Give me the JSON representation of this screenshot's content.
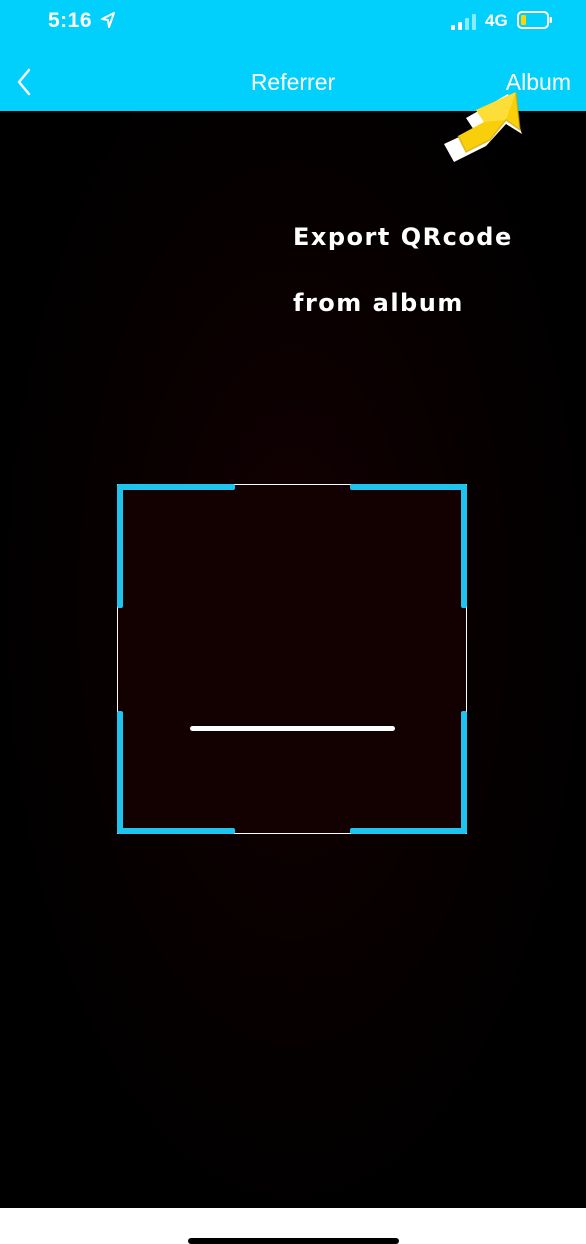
{
  "status_bar": {
    "time": "5:16",
    "network": "4G",
    "location_icon": "location-arrow-icon",
    "signal_icon": "cellular-signal-icon",
    "battery_icon": "battery-low-icon",
    "battery_color": "#ffd700"
  },
  "nav": {
    "back_icon": "chevron-left-icon",
    "title": "Referrer",
    "album_label": "Album",
    "background_color": "#00d0fb"
  },
  "hint": {
    "line1": "Export QRcode",
    "line2": "from album",
    "arrow_icon": "yellow-arrow-pointing-up-right-icon"
  },
  "scanner": {
    "frame_accent_color": "#1ec4ee"
  }
}
